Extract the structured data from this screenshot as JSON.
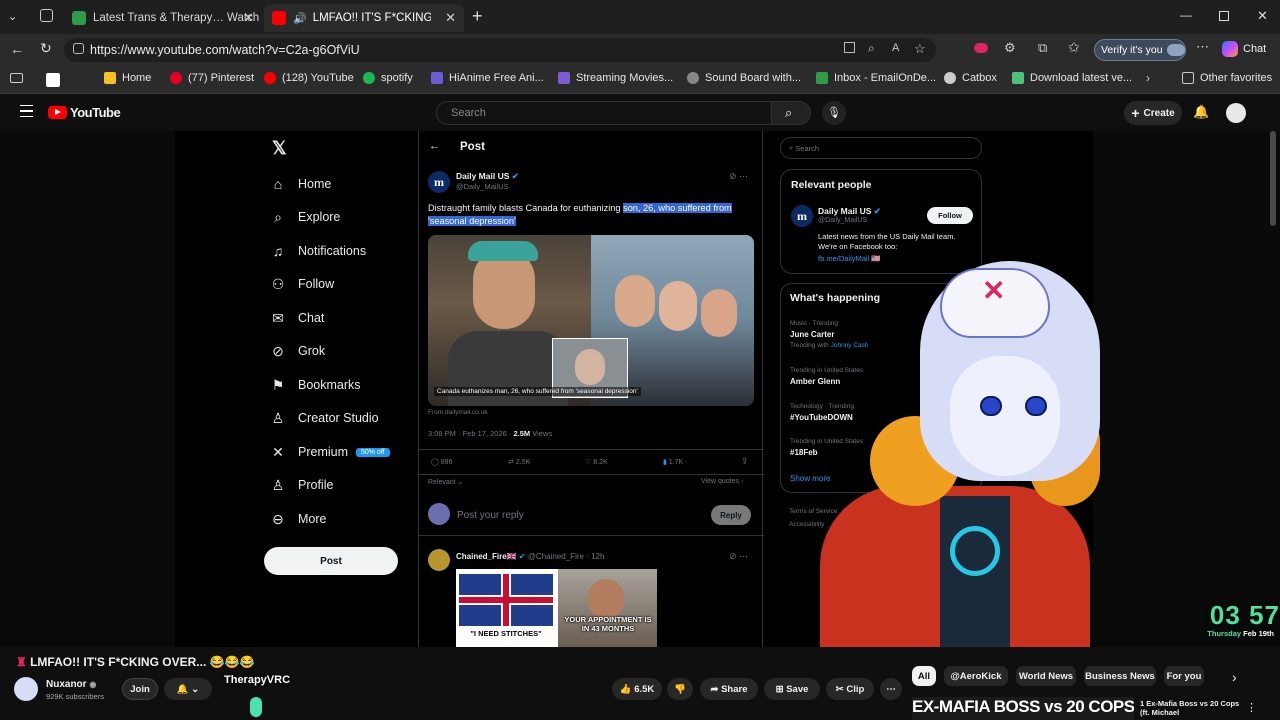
{
  "browser": {
    "tabs": [
      {
        "title": "Latest Trans & Therapy… Watch Live -",
        "color": "#2e9c48",
        "active": false
      },
      {
        "title": "LMFAO!! IT'S F*CKING OV",
        "color": "#ff0000",
        "active": true
      }
    ],
    "url": "https://www.youtube.com/watch?v=C2a-g6OfViU",
    "verify_label": "Verify it's you",
    "chat_label": "Chat",
    "bookmarks": [
      {
        "label": "Home",
        "color": "#f6c026"
      },
      {
        "label": "(77) Pinterest",
        "color": "#e60023"
      },
      {
        "label": "(128) YouTube",
        "color": "#ff0000"
      },
      {
        "label": "spotify",
        "color": "#1db954"
      },
      {
        "label": "HiAnime Free Ani...",
        "color": "#6b5bd6"
      },
      {
        "label": "Streaming Movies...",
        "color": "#7b5bd6"
      },
      {
        "label": "Sound Board with...",
        "color": "#888888"
      },
      {
        "label": "Inbox - EmailOnDe...",
        "color": "#2e9c48"
      },
      {
        "label": "Catbox",
        "color": "#cccccc"
      },
      {
        "label": "Download latest ve...",
        "color": "#4ec27a"
      },
      {
        "label": "Other favorites",
        "color": "#f6c026"
      }
    ]
  },
  "youtube": {
    "logo": "YouTube",
    "search_placeholder": "Search",
    "create_label": "Create",
    "video_title": "LMFAO!! IT'S F*CKING OVER... 😂😂😂",
    "channel_name": "Nuxanor",
    "subscribers": "929K subscribers",
    "join_label": "Join",
    "likes": "6.5K",
    "share_label": "Share",
    "save_label": "Save",
    "clip_label": "Clip",
    "overlay_name": "TherapyVRC",
    "chips": [
      "All",
      "@AeroKick",
      "World News",
      "Business News",
      "For you"
    ],
    "rec_title": "1 Ex-Mafia Boss vs 20 Cops (ft. Michael",
    "rec_thumb_text": "EX-MAFIA BOSS vs 20 COPS"
  },
  "x_page": {
    "nav": [
      "Home",
      "Explore",
      "Notifications",
      "Follow",
      "Chat",
      "Grok",
      "Bookmarks",
      "Creator Studio",
      "Premium",
      "Profile",
      "More"
    ],
    "premium_badge": "50% off",
    "post_button": "Post",
    "header": "Post",
    "author": "Daily Mail US",
    "handle": "@Daily_MailUS",
    "text_plain": "Distraught family blasts Canada for euthanizing ",
    "text_highlight": "son, 26, who suffered from 'seasonal depression'",
    "image_caption": "Canada euthanizes man, 26, who suffered from 'seasonal depression'",
    "source": "From dailymail.co.uk",
    "timestamp": "3:08 PM · Feb 17, 2026 ·",
    "views_count": "2.5M",
    "views_label": "Views",
    "stats": {
      "replies": "896",
      "reposts": "2.5K",
      "likes": "8.2K",
      "bookmarks": "1.7K"
    },
    "relevant_label": "Relevant",
    "view_quotes": "View quotes",
    "reply_placeholder": "Post your reply",
    "reply_button": "Reply",
    "reply_author": "Chained_Fire🇬🇧",
    "reply_handle": "@Chained_Fire · 12h",
    "meme_left": "\"I NEED STITCHES\"",
    "meme_right": "YOUR APPOINTMENT IS IN 43 MONTHS",
    "right_search": "Search",
    "relevant_people": "Relevant people",
    "rp_name": "Daily Mail US",
    "rp_handle": "@Daily_MailUS",
    "rp_follow": "Follow",
    "rp_bio": "Latest news from the US Daily Mail team. We're on Facebook too:",
    "rp_link": "fb.me/DailyMail 🇺🇸",
    "whats_happening": "What's happening",
    "trends": [
      {
        "meta": "Music · Trending",
        "name": "June Carter",
        "sub": "Trending with Johnny Cash"
      },
      {
        "meta": "Trending in United States",
        "name": "Amber Glenn",
        "sub": ""
      },
      {
        "meta": "Technology · Trending",
        "name": "#YouTubeDOWN",
        "sub": ""
      },
      {
        "meta": "Trending in United States",
        "name": "#18Feb",
        "sub": ""
      }
    ],
    "show_more": "Show more",
    "terms": "Terms of Service",
    "accessibility": "Accessibility"
  },
  "clock": {
    "time": "03 57",
    "day": "Thursday",
    "date": "Feb 19th"
  }
}
